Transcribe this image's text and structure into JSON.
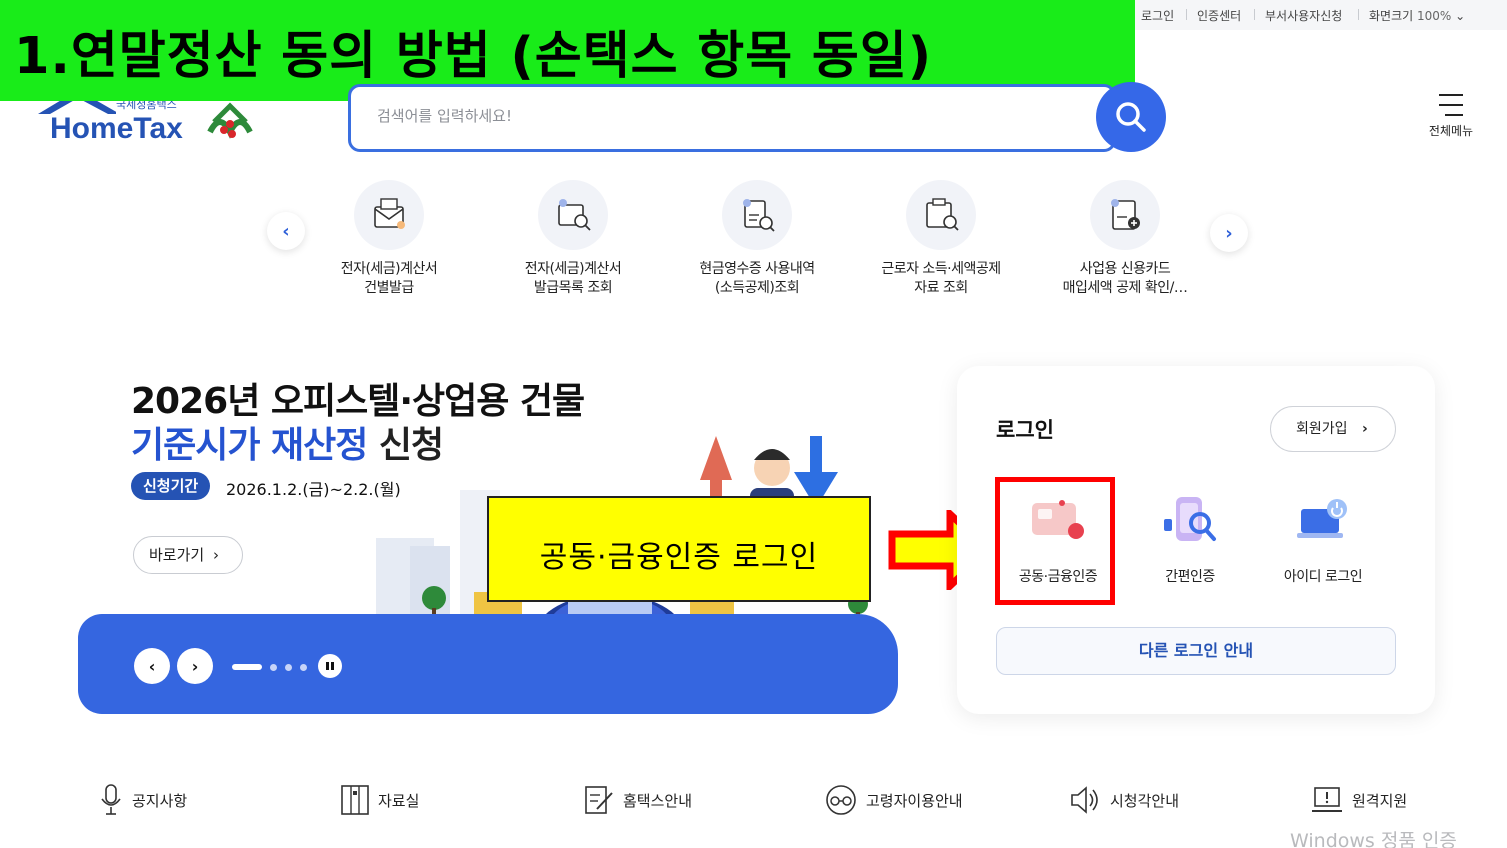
{
  "overlay": {
    "title": "1.연말정산 동의 방법 (손택스 항목 동일)",
    "callout": "공동·금융인증 로그인"
  },
  "utilbar": {
    "login": "로그인",
    "cert_center": "인증센터",
    "dept_user": "부서사용자신청",
    "zoom_label": "화면크기",
    "zoom_value": "100%"
  },
  "logo": {
    "sub": "국세청홈택스",
    "name": "HomeTax"
  },
  "search": {
    "placeholder": "검색어를 입력하세요!"
  },
  "menu": {
    "label": "전체메뉴"
  },
  "quick_menu": [
    {
      "line1": "전자(세금)계산서",
      "line2": "건별발급"
    },
    {
      "line1": "전자(세금)계산서",
      "line2": "발급목록 조회"
    },
    {
      "line1": "현금영수증 사용내역",
      "line2": "(소득공제)조회"
    },
    {
      "line1": "근로자 소득·세액공제",
      "line2": "자료 조회"
    },
    {
      "line1": "사업용 신용카드",
      "line2": "매입세액 공제 확인/…"
    }
  ],
  "banner": {
    "title_line1": "2026년 오피스텔·상업용 건물",
    "title_blue": "기준시가 재산정",
    "title_dark": " 신청",
    "period_badge": "신청기간",
    "period_date": "2026.1.2.(금)~2.2.(월)",
    "go_label": "바로가기"
  },
  "login": {
    "title": "로그인",
    "join": "회원가입",
    "options": [
      "공동·금융인증",
      "간편인증",
      "아이디 로그인"
    ],
    "other": "다른 로그인 안내"
  },
  "bottom": [
    "공지사항",
    "자료실",
    "홈택스안내",
    "고령자이용안내",
    "시청각안내",
    "원격지원"
  ],
  "watermark": "Windows 정품 인증",
  "colors": {
    "brand_blue": "#2553b4",
    "accent_blue": "#3568e8",
    "overlay_green": "#19ec19",
    "callout_yellow": "#ffff00",
    "highlight_red": "#ff0000"
  }
}
